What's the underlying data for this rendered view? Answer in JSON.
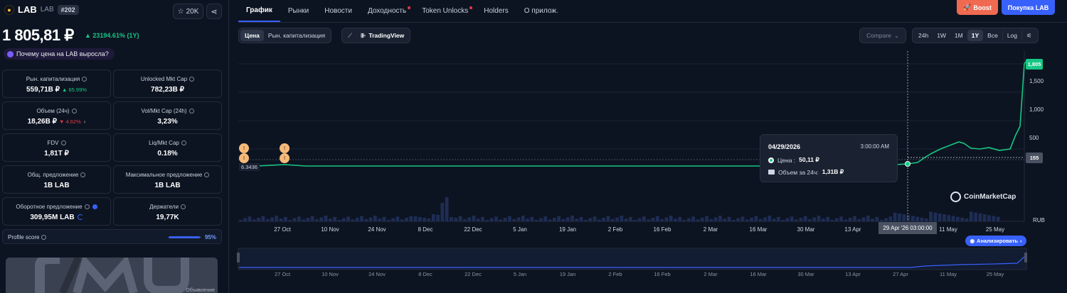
{
  "token": {
    "name": "LAB",
    "symbol": "LAB",
    "rank": "#202",
    "stars": "20K",
    "price": "1 805,81 ₽",
    "change": "▲ 23194.61% (1Y)",
    "why": "Почему цена на LAB выросла?"
  },
  "stats": [
    {
      "label": "Рын. капитализация",
      "value": "559,71B ₽",
      "delta": "▲ 65.99%",
      "delta_dir": "up"
    },
    {
      "label": "Unlocked Mkt Cap",
      "value": "782,23B ₽"
    },
    {
      "label": "Объем (24ч)",
      "value": "18,26B ₽",
      "delta": "▼ 4.62%",
      "delta_dir": "down"
    },
    {
      "label": "Vol/Mkt Cap (24h)",
      "value": "3,23%"
    },
    {
      "label": "FDV",
      "value": "1,81T ₽"
    },
    {
      "label": "Liq/Mkt Cap",
      "value": "0.18%"
    },
    {
      "label": "Общ. предложение",
      "value": "1B LAB"
    },
    {
      "label": "Максимальное предложение",
      "value": "1B LAB"
    },
    {
      "label": "Оборотное предложение",
      "value": "309,95M LAB"
    },
    {
      "label": "Держатели",
      "value": "19,77K"
    }
  ],
  "profile": {
    "label": "Profile score",
    "value": "95%",
    "score": 0.95
  },
  "banner": {
    "ad_label": "Объявление"
  },
  "tabs": [
    {
      "label": "График",
      "active": true
    },
    {
      "label": "Рынки"
    },
    {
      "label": "Новости"
    },
    {
      "label": "Доходность",
      "dot": true
    },
    {
      "label": "Token Unlocks",
      "dot": true
    },
    {
      "label": "Holders"
    },
    {
      "label": "О прилож."
    }
  ],
  "actions": {
    "boost": "Boost",
    "buy": "Покупка LAB"
  },
  "toolbar": {
    "price_tab": "Цена",
    "mcap_tab": "Рын. капитализация",
    "tradingview": "TradingView",
    "compare": "Compare",
    "ranges": [
      "24h",
      "1W",
      "1M",
      "1Y",
      "Все"
    ],
    "active_range": "1Y",
    "log": "Log"
  },
  "tooltip": {
    "date": "04/29/2026",
    "time": "3:00:00 AM",
    "price_label": "Цена :",
    "price": "50,11 ₽",
    "volume_label": "Объем за 24ч:",
    "volume": "1,31B ₽"
  },
  "chart_data": {
    "type": "line",
    "y_ticks": [
      "1,805",
      "1,500",
      "1,000",
      "500",
      "155"
    ],
    "y_tags": {
      "current": "1,805",
      "crosshair": "155"
    },
    "start_label": "6.3436",
    "currency": "RUB",
    "x_ticks": [
      "27 Oct",
      "10 Nov",
      "24 Nov",
      "8 Dec",
      "22 Dec",
      "5 Jan",
      "19 Jan",
      "2 Feb",
      "16 Feb",
      "2 Mar",
      "16 Mar",
      "30 Mar",
      "13 Apr",
      "27 Apr",
      "11 May",
      "25 May"
    ],
    "crosshair_x": "29 Apr '26 03:00:00",
    "series": [
      {
        "values": [
          6.34,
          7,
          6.5,
          6.8,
          6.6,
          6.9,
          7.1,
          7.5,
          8,
          9,
          12,
          20,
          50.11,
          155,
          420,
          520,
          460,
          480,
          440,
          470,
          700,
          1805.81
        ]
      }
    ],
    "ylim": [
      0,
      1900
    ]
  },
  "watermark": "CoinMarketCap",
  "analyze": "Анализировать"
}
